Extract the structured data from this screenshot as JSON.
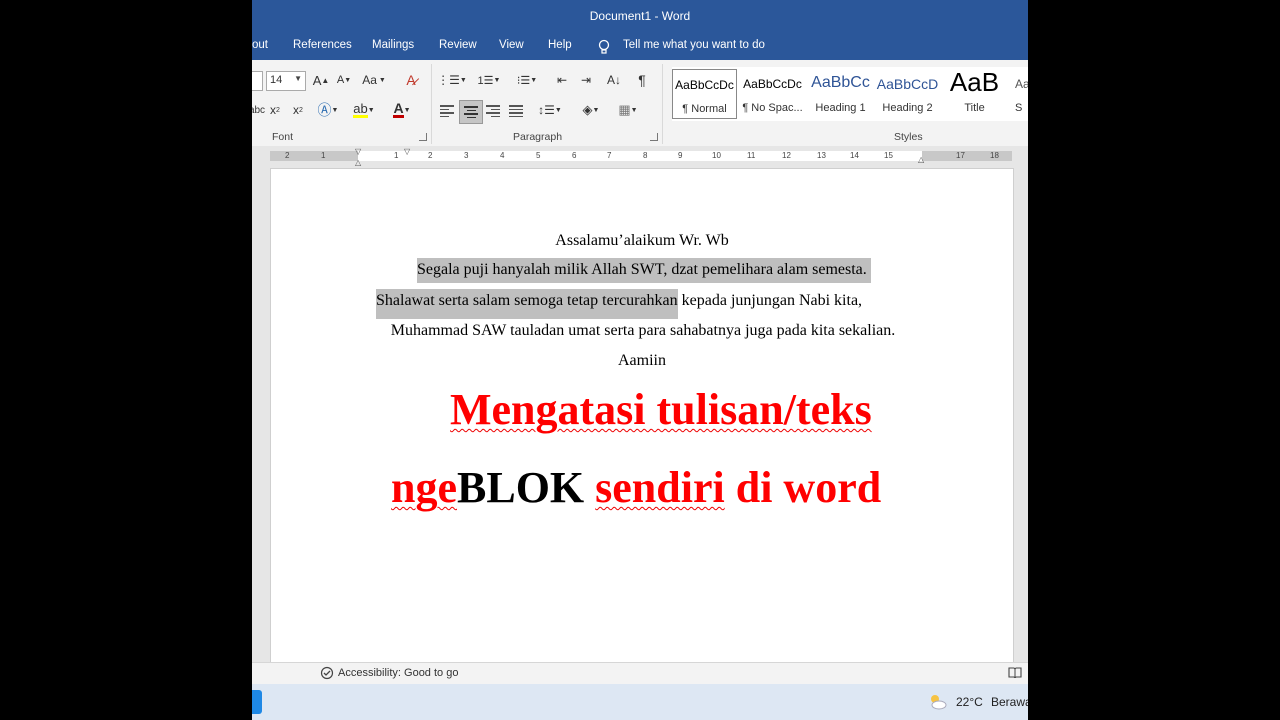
{
  "window": {
    "title": "Document1  -  Word"
  },
  "menu": {
    "layout_partial": "out",
    "references": "References",
    "mailings": "Mailings",
    "review": "Review",
    "view": "View",
    "help": "Help",
    "tell_me": "Tell me what you want to do"
  },
  "ribbon": {
    "font_size": "14",
    "font_group_label": "Font",
    "paragraph_group_label": "Paragraph",
    "styles_group_label": "Styles",
    "styles": [
      {
        "preview": "AaBbCcDc",
        "name": "¶ Normal"
      },
      {
        "preview": "AaBbCcDc",
        "name": "¶ No Spac..."
      },
      {
        "preview": "AaBbCc",
        "name": "Heading 1"
      },
      {
        "preview": "AaBbCcD",
        "name": "Heading 2"
      },
      {
        "preview": "AaB",
        "name": "Title"
      },
      {
        "preview": "Aa",
        "name": "S"
      }
    ]
  },
  "ruler": {
    "numbers": [
      "2",
      "1",
      "1",
      "1",
      "2",
      "3",
      "4",
      "5",
      "6",
      "7",
      "8",
      "9",
      "10",
      "11",
      "12",
      "13",
      "14",
      "15",
      "16",
      "17",
      "18"
    ]
  },
  "document": {
    "greeting": "Assalamu’alaikum Wr. Wb",
    "line1": "Segala puji hanyalah milik Allah SWT, dzat pemelihara alam semesta.",
    "line2_highlighted": "Shalawat serta salam semoga tetap tercurahkan",
    "line2_rest": " kepada junjungan Nabi kita,",
    "line3": "Muhammad SAW tauladan umat serta para sahabatnya juga pada kita sekalian.",
    "line4": "Aamiin",
    "heading_line1": "Mengatasi tulisan/teks",
    "heading_line2_a": "nge",
    "heading_line2_b": "BLOK",
    "heading_line2_c": " ",
    "heading_line2_d": "sendiri",
    "heading_line2_e": " di word"
  },
  "status": {
    "accessibility": "Accessibility: Good to go"
  },
  "taskbar": {
    "temperature": "22°C",
    "weather": "Berawa"
  },
  "colors": {
    "word_blue": "#2b579a",
    "heading_red": "#ff0000",
    "highlight_gray": "#bfbfbf"
  }
}
